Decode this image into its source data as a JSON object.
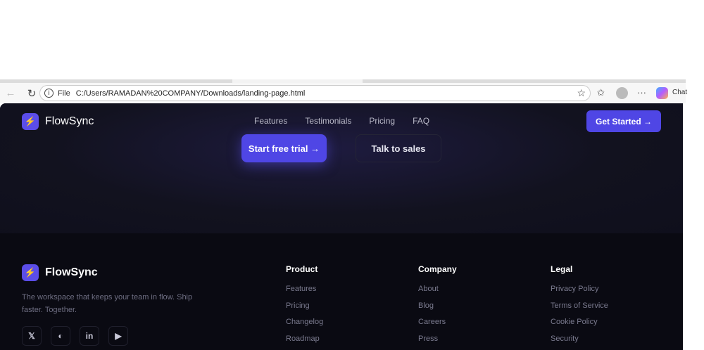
{
  "browser": {
    "file_label": "File",
    "url": "C:/Users/RAMADAN%20COMPANY/Downloads/landing-page.html",
    "chat_label": "Chat"
  },
  "header": {
    "brand": "FlowSync",
    "nav": [
      "Features",
      "Testimonials",
      "Pricing",
      "FAQ"
    ],
    "cta": "Get Started →"
  },
  "hero": {
    "primary": "Start free trial →",
    "secondary": "Talk to sales"
  },
  "footer": {
    "brand": "FlowSync",
    "tagline": "The workspace that keeps your team in flow. Ship faster. Together.",
    "social": [
      "x-icon",
      "github-icon",
      "linkedin-icon",
      "youtube-icon"
    ],
    "columns": [
      {
        "title": "Product",
        "links": [
          "Features",
          "Pricing",
          "Changelog",
          "Roadmap"
        ]
      },
      {
        "title": "Company",
        "links": [
          "About",
          "Blog",
          "Careers",
          "Press"
        ]
      },
      {
        "title": "Legal",
        "links": [
          "Privacy Policy",
          "Terms of Service",
          "Cookie Policy",
          "Security"
        ]
      }
    ]
  },
  "colors": {
    "accent": "#4f46e5",
    "bg": "#0f0f1c",
    "footer_bg": "#0a0a12"
  }
}
